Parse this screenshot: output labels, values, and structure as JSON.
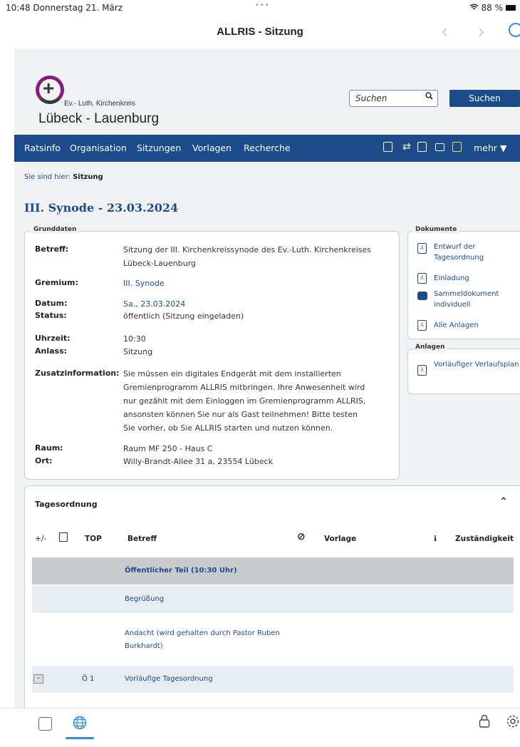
{
  "status_bar": {
    "time": "10:48  Donnerstag 21. März",
    "dots": "•••",
    "battery": "88 %"
  },
  "browser": {
    "title": "ALLRIS - Sitzung",
    "back": "‹",
    "forward": "›"
  },
  "header": {
    "logo_sub": "Ev.- Luth. Kirchenkreis",
    "logo_main": "Lübeck - Lauenburg",
    "search_placeholder": "Suchen",
    "search_button": "Suchen"
  },
  "menu": {
    "items": [
      "Ratsinfo",
      "Organisation",
      "Sitzungen",
      "Vorlagen",
      "Recherche"
    ],
    "more": "mehr ▼"
  },
  "breadcrumb": {
    "prefix": "Sie sind hier:",
    "current": "Sitzung"
  },
  "page_title": "III. Synode - 23.03.2024",
  "grunddaten": {
    "legend": "Grunddaten",
    "rows": [
      {
        "label": "Betreff:",
        "value": "Sitzung der III. Kirchenkreissynode des Ev.-Luth. Kirchenkreises Lübeck-Lauenburg"
      },
      {
        "label": "Gremium:",
        "value": "III. Synode"
      },
      {
        "label": "Datum:",
        "value": "Sa., 23.03.2024"
      },
      {
        "label": "Status:",
        "value": "öffentlich (Sitzung eingeladen)"
      },
      {
        "label": "Uhrzeit:",
        "value": "10:30"
      },
      {
        "label": "Anlass:",
        "value": "Sitzung"
      },
      {
        "label": "Zusatzinformation:",
        "value": "Sie müssen ein digitales Endgerät mit dem installierten Gremienprogramm ALLRIS mitbringen. Ihre Anwesenheit wird nur gezählt mit dem Einloggen im Gremienprogramm ALLRIS, ansonsten können Sie nur als Gast teilnehmen! Bitte testen Sie vorher, ob Sie ALLRIS starten und nutzen können."
      },
      {
        "label": "Raum:",
        "value": "Raum MF 250 - Haus C"
      },
      {
        "label": "Ort:",
        "value": "Willy-Brandt-Allee 31 a, 23554 Lübeck"
      }
    ]
  },
  "dokumente": {
    "legend": "Dokumente",
    "items": [
      "Entwurf der Tagesordnung",
      "Einladung",
      "Sammeldokument individuell",
      "Alle Anlagen"
    ]
  },
  "anlagen": {
    "legend": "Anlagen",
    "items": [
      "Vorläufiger Verlaufsplan"
    ]
  },
  "tagesordnung": {
    "title": "Tagesordnung",
    "collapse": "⌃",
    "columns": {
      "toggle": "+/-",
      "top": "TOP",
      "betreff": "Betreff",
      "vorlage": "Vorlage",
      "info": "i",
      "zustaendigkeit": "Zuständigkeit"
    },
    "rows": [
      {
        "top": "",
        "betreff": "Öffentlicher Teil (10:30 Uhr)"
      },
      {
        "top": "",
        "betreff": "Begrüßung"
      },
      {
        "top": "",
        "betreff": "Andacht (wird gehalten durch Pastor Ruben Burkhardt)"
      },
      {
        "top": "Ö 1",
        "betreff": "Vorläufige Tagesordnung"
      }
    ]
  },
  "colors": {
    "brand": "#1b4b8a",
    "logo_purple": "#8a1b7e",
    "section_row": "#c9cacc",
    "alt_row": "#e8ecf3"
  }
}
